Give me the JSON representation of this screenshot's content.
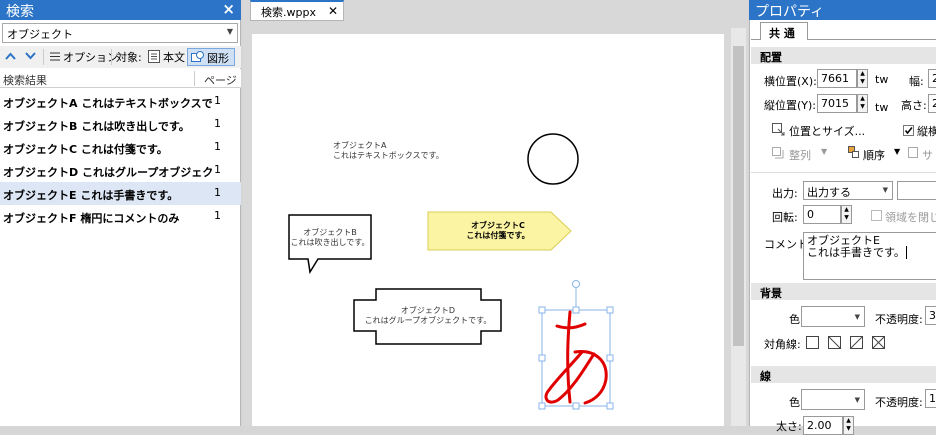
{
  "search_pane": {
    "title": "検索",
    "close": "×",
    "query": "オブジェクト",
    "options_label": "オプション",
    "target_label": "対象:",
    "target_text": "本文",
    "target_shape": "図形",
    "col_results": "検索結果",
    "col_page": "ページ",
    "results": [
      {
        "text": "オブジェクトA これはテキストボックスで",
        "page": "1"
      },
      {
        "text": "オブジェクトB これは吹き出しです。",
        "page": "1"
      },
      {
        "text": "オブジェクトC これは付箋です。",
        "page": "1"
      },
      {
        "text": "オブジェクトD これはグループオブジェク",
        "page": "1"
      },
      {
        "text": "オブジェクトE これは手書きです。",
        "page": "1"
      },
      {
        "text": "オブジェクトF 楕円にコメントのみ",
        "page": "1"
      }
    ]
  },
  "document": {
    "tab_label": "検索.wppx",
    "shapes": {
      "a_line1": "オブジェクトA",
      "a_line2": "これはテキストボックスです。",
      "b_line1": "オブジェクトB",
      "b_line2": "これは吹き出しです。",
      "c_line1": "オブジェクトC",
      "c_line2": "これは付箋です。",
      "d_line1": "オブジェクトD",
      "d_line2": "これはグループオブジェクトです。"
    }
  },
  "properties": {
    "title": "プロパティ",
    "tab": "共 通",
    "placement": {
      "header": "配置",
      "x_label": "横位置(X):",
      "x_value": "7661",
      "y_label": "縦位置(Y):",
      "y_value": "7015",
      "unit": "tw",
      "width_label": "幅:",
      "width_value": "2",
      "height_label": "高さ:",
      "height_value": "2",
      "pos_size": "位置とサイズ...",
      "lock_label": "縦横",
      "align": "整列",
      "order": "順序",
      "extra": "サ"
    },
    "output_label": "出力:",
    "output_value": "出力する",
    "rotate_label": "回転:",
    "rotate_value": "0",
    "close_area": "領域を閉じる",
    "comment_label": "コメント:",
    "comment_line1": "オブジェクトE",
    "comment_line2": "これは手書きです。",
    "background": {
      "header": "背景",
      "color_label": "色:",
      "opacity_label": "不透明度:",
      "opacity_value": "3",
      "diag_label": "対角線:"
    },
    "line": {
      "header": "線",
      "color_label": "色:",
      "opacity_label": "不透明度:",
      "opacity_value": "1",
      "thickness_label": "太さ:",
      "thickness_value": "2.00"
    }
  }
}
